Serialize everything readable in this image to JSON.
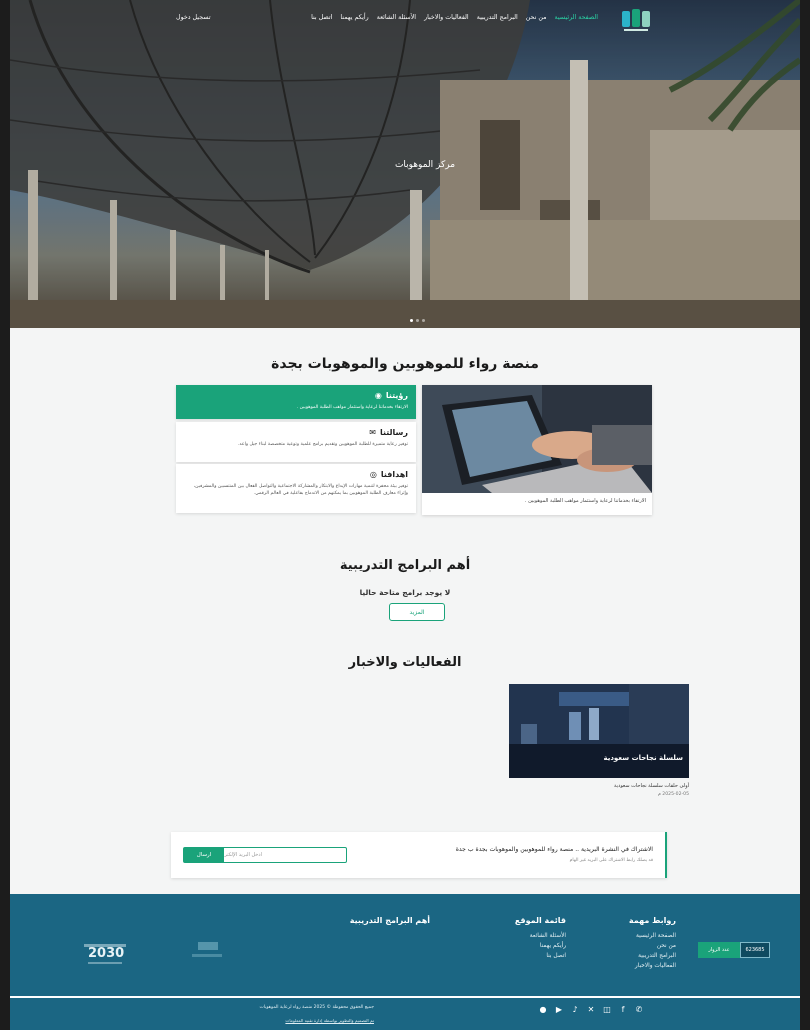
{
  "nav": {
    "links": [
      "الصفحة الرئيسية",
      "من نحن",
      "البرامج التدريبية",
      "الفعاليات والاخبار",
      "الأسئلة الشائعة",
      "رأيكم يهمنا",
      "اتصل بنا"
    ],
    "login": "تسجيل دخول"
  },
  "hero": {
    "title": "مركز الموهوبات",
    "slides": 3
  },
  "about": {
    "title": "منصة رواء للموهوبين والموهوبات بجدة",
    "image_caption": "الارتقاء بخدماتنا لرعاية واستثمار مواهب الطلبة الموهوبين .",
    "vision": {
      "title": "رؤيتنا",
      "text": "الارتقاء بخدماتنا لرعاية واستثمار مواهب الطلبة الموهوبين ."
    },
    "mission": {
      "title": "رسالتنا",
      "text": "توفير رعاية متميزة للطلبة الموهوبين وتقديم برامج علمية وتوعية متخصصة لبناء جيل واعد."
    },
    "goals": {
      "title": "اهدافنا",
      "text": "توفير بيئة محفزة لتنمية مهارات الإبداع والابتكار والمشاركة الاجتماعية والتواصل الفعال بين المنتسبين والمشرفين، وإثراء معارف الطلبة الموهوبين بما يمكنهم من الاندماج بفاعلية في العالم الرقمي."
    }
  },
  "programs": {
    "title": "أهم البرامج التدريبية",
    "empty": "لا يوجد برامج متاحة حاليا",
    "more_label": "المزيد"
  },
  "events": {
    "title": "الفعاليات والاخبار",
    "items": [
      {
        "overlay": "سلسلة نجاحات سعودية",
        "title": "أولى حلقات سلسلة نجاحات سعودية",
        "date": "2025-02-05 م"
      }
    ]
  },
  "newsletter": {
    "title": "الاشتراك في النشرة البريدية .. منصة رواء للموهوبين والموهوبات بجدة ب جدة",
    "subtitle": "قد يصلك رابط الاشتراك على البريد غير الهام",
    "placeholder": "ادخل البريد الإلكتروني",
    "button": "ارسال"
  },
  "footer": {
    "links_title": "روابط مهمة",
    "links": [
      "الصفحة الرئيسية",
      "من نحن",
      "البرامج التدريبية",
      "الفعاليات والاخبار"
    ],
    "menu_title": "قائمة الموقع",
    "menu": [
      "الأسئلة الشائعة",
      "رأيكم يهمنا",
      "اتصل بنا"
    ],
    "programs_title": "أهم البرامج التدريبية",
    "visitors_label": "عدد الزوار",
    "visitors_count": "623685",
    "vision_logo": "2030",
    "copyright": "جميع الحقوق محفوظة © 2025 منصة رواء لرعاية الموهوبات",
    "credits": "تم التصميم والتطوير بواسطة إدارة تقنية المعلومات",
    "social": [
      "whatsapp-icon",
      "facebook-icon",
      "instagram-icon",
      "twitter-icon",
      "tiktok-icon",
      "youtube-icon",
      "snapchat-icon"
    ]
  },
  "colors": {
    "accent": "#1aa37a",
    "footer": "#1b6683",
    "background": "#f4f5f5"
  }
}
